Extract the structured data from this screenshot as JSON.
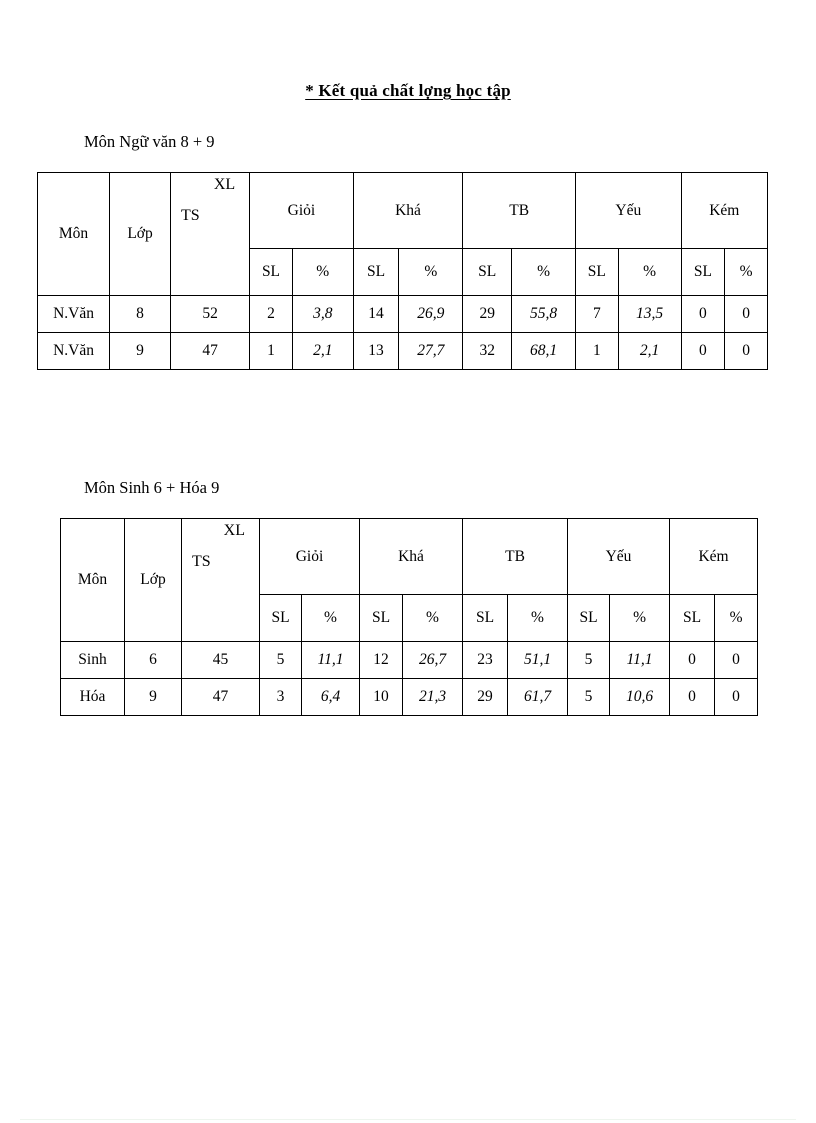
{
  "document": {
    "title": "* Kết quả chất lợng   học tập"
  },
  "sections": [
    {
      "caption": "Môn Ngữ văn 8 + 9",
      "table": {
        "headers": {
          "mon": "Môn",
          "lop": "Lớp",
          "xl": "XL",
          "ts": "TS",
          "groups": [
            "Giỏi",
            "Khá",
            "TB",
            "Yếu",
            "Kém"
          ],
          "sub_sl": "SL",
          "sub_pct": "%"
        },
        "rows": [
          {
            "mon": "N.Văn",
            "lop": "8",
            "ts": "52",
            "gioi_sl": "2",
            "gioi_pct": "3,8",
            "kha_sl": "14",
            "kha_pct": "26,9",
            "tb_sl": "29",
            "tb_pct": "55,8",
            "yeu_sl": "7",
            "yeu_pct": "13,5",
            "kem_sl": "0",
            "kem_pct": "0"
          },
          {
            "mon": "N.Văn",
            "lop": "9",
            "ts": "47",
            "gioi_sl": "1",
            "gioi_pct": "2,1",
            "kha_sl": "13",
            "kha_pct": "27,7",
            "tb_sl": "32",
            "tb_pct": "68,1",
            "yeu_sl": "1",
            "yeu_pct": "2,1",
            "kem_sl": "0",
            "kem_pct": "0"
          }
        ]
      }
    },
    {
      "caption": "Môn Sinh 6 + Hóa 9",
      "table": {
        "headers": {
          "mon": "Môn",
          "lop": "Lớp",
          "xl": "XL",
          "ts": "TS",
          "groups": [
            "Giỏi",
            "Khá",
            "TB",
            "Yếu",
            "Kém"
          ],
          "sub_sl": "SL",
          "sub_pct": "%"
        },
        "rows": [
          {
            "mon": "Sinh",
            "lop": "6",
            "ts": "45",
            "gioi_sl": "5",
            "gioi_pct": "11,1",
            "kha_sl": "12",
            "kha_pct": "26,7",
            "tb_sl": "23",
            "tb_pct": "51,1",
            "yeu_sl": "5",
            "yeu_pct": "11,1",
            "kem_sl": "0",
            "kem_pct": "0"
          },
          {
            "mon": "Hóa",
            "lop": "9",
            "ts": "47",
            "gioi_sl": "3",
            "gioi_pct": "6,4",
            "kha_sl": "10",
            "kha_pct": "21,3",
            "tb_sl": "29",
            "tb_pct": "61,7",
            "yeu_sl": "5",
            "yeu_pct": "10,6",
            "kem_sl": "0",
            "kem_pct": "0"
          }
        ]
      }
    }
  ]
}
